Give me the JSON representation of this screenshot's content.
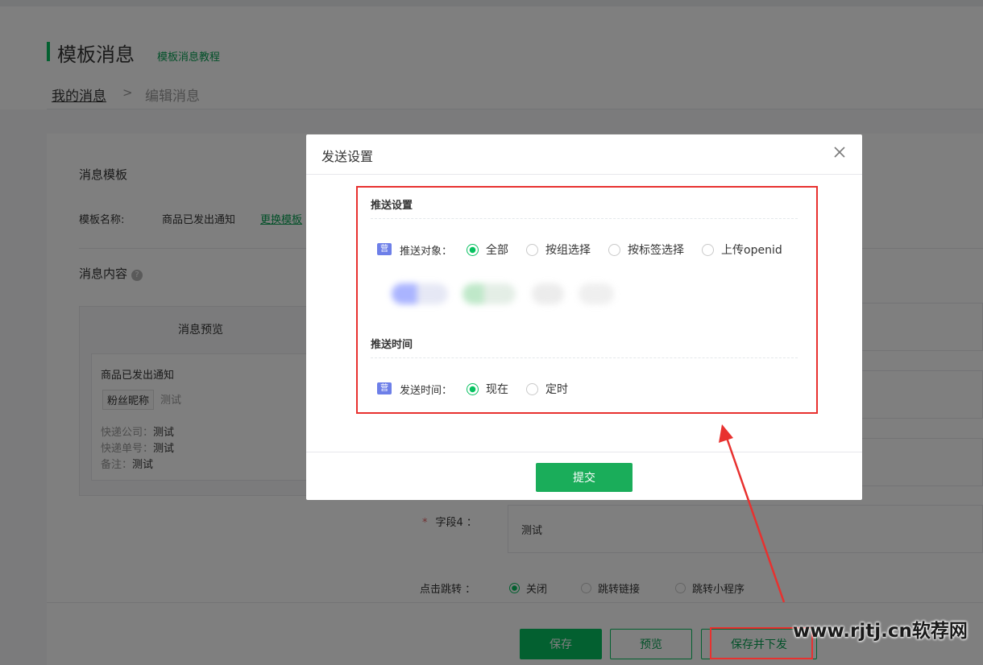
{
  "header": {
    "title": "模板消息",
    "tutorial_link": "模板消息教程",
    "breadcrumb": {
      "parent": "我的消息",
      "separator": ">",
      "current": "编辑消息"
    }
  },
  "card": {
    "template_section_title": "消息模板",
    "template_name_label": "模板名称:",
    "template_name_value": "商品已发出通知",
    "change_template_link": "更换模板",
    "content_section_title": "消息内容",
    "preview": {
      "title": "消息预览",
      "message_name": "商品已发出通知",
      "fan_nickname_chip": "粉丝昵称",
      "chip_value": "测试",
      "lines": [
        {
          "label": "快递公司：",
          "value": "测试"
        },
        {
          "label": "快递单号：",
          "value": "测试"
        },
        {
          "label": "备注：",
          "value": "测试"
        }
      ]
    },
    "field4": {
      "star": "*",
      "label": "字段4 ：",
      "value": "测试"
    },
    "jump": {
      "label": "点击跳转 ：",
      "options": [
        "关闭",
        "跳转链接",
        "跳转小程序"
      ],
      "selected": "关闭"
    },
    "buttons": {
      "save": "保存",
      "preview": "预览",
      "save_and_send": "保存并下发"
    }
  },
  "dialog": {
    "title": "发送设置",
    "push_settings": {
      "title": "推送设置",
      "badge": "营",
      "target_label": "推送对象：",
      "options": [
        "全部",
        "按组选择",
        "按标签选择",
        "上传openid"
      ],
      "selected": "全部"
    },
    "push_time": {
      "title": "推送时间",
      "badge": "营",
      "time_label": "发送时间：",
      "options": [
        "现在",
        "定时"
      ],
      "selected": "现在"
    },
    "submit_label": "提交"
  },
  "watermark": "www.rjtj.cn软荐网",
  "colors": {
    "brand_green": "#07c160",
    "annotation_red": "#e8312f",
    "badge_blue": "#6d7fe8"
  }
}
